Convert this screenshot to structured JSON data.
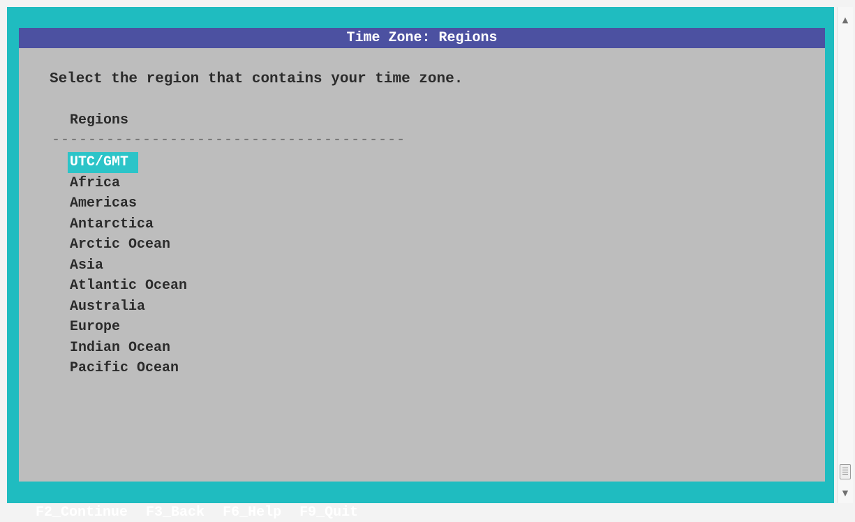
{
  "dialog": {
    "title": "Time Zone: Regions",
    "prompt": "Select the region that contains your time zone.",
    "list_header": "Regions",
    "divider": "---------------------------------------",
    "regions": [
      {
        "label": "UTC/GMT",
        "selected": true
      },
      {
        "label": "Africa"
      },
      {
        "label": "Americas"
      },
      {
        "label": "Antarctica"
      },
      {
        "label": "Arctic Ocean"
      },
      {
        "label": "Asia"
      },
      {
        "label": "Atlantic Ocean"
      },
      {
        "label": "Australia"
      },
      {
        "label": "Europe"
      },
      {
        "label": "Indian Ocean"
      },
      {
        "label": "Pacific Ocean"
      }
    ]
  },
  "footer": {
    "keys": [
      "F2_Continue",
      "F3_Back",
      "F6_Help",
      "F9_Quit"
    ]
  },
  "scrollbar": {
    "up_icon": "triangle-up-icon",
    "down_icon": "triangle-down-icon",
    "grip_icon": "grip-lines-icon"
  },
  "colors": {
    "background": "#1fbcc0",
    "dialog": "#bdbdbd",
    "title_bar": "#4c51a1",
    "selection": "#2cc4c8"
  }
}
